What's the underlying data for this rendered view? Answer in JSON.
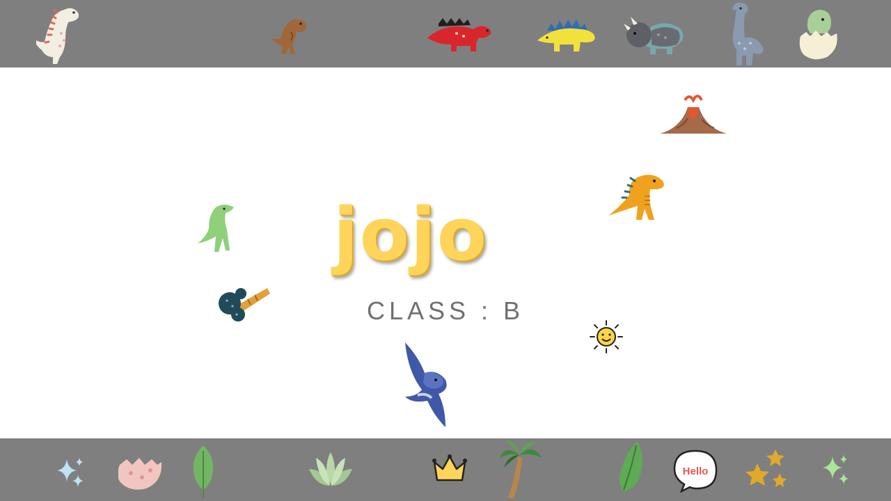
{
  "slide": {
    "name": "jojo",
    "class_label": "CLASS : B",
    "colors": {
      "band": "#7f7f7f",
      "background": "#ffffff",
      "name_fill": "#ffd45a",
      "class_text": "#707070"
    }
  },
  "stickers": {
    "hello_bubble_text": "Hello"
  }
}
